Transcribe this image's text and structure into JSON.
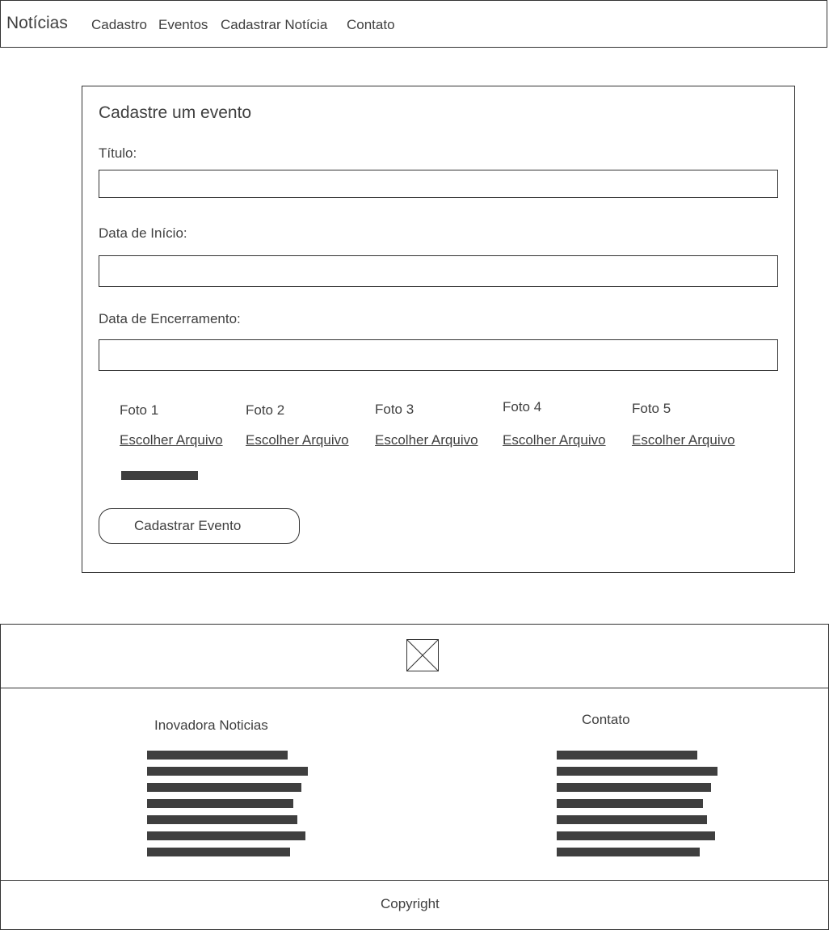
{
  "navbar": {
    "brand": "Notícias",
    "links": [
      "Cadastro",
      "Eventos",
      "Cadastrar Notícia",
      "Contato"
    ]
  },
  "form": {
    "title": "Cadastre um evento",
    "fields": [
      {
        "label": "Título:",
        "value": ""
      },
      {
        "label": "Data de Início:",
        "value": ""
      },
      {
        "label": "Data de Encerramento:",
        "value": ""
      }
    ],
    "photos": [
      {
        "label": "Foto 1",
        "action": "Escolher Arquivo"
      },
      {
        "label": "Foto 2",
        "action": "Escolher Arquivo"
      },
      {
        "label": "Foto 3",
        "action": "Escolher Arquivo"
      },
      {
        "label": "Foto 4",
        "action": "Escolher Arquivo"
      },
      {
        "label": "Foto 5",
        "action": "Escolher Arquivo"
      }
    ],
    "submit_label": "Cadastrar Evento"
  },
  "footer": {
    "logo_icon": "image-placeholder-icon",
    "columns": [
      {
        "title": "Inovadora Noticias"
      },
      {
        "title": "Contato"
      }
    ],
    "copyright": "Copyright"
  },
  "colors": {
    "text": "#3f3f3f",
    "border": "#333333",
    "placeholder_bar": "#3f3f3f",
    "background": "#ffffff"
  }
}
